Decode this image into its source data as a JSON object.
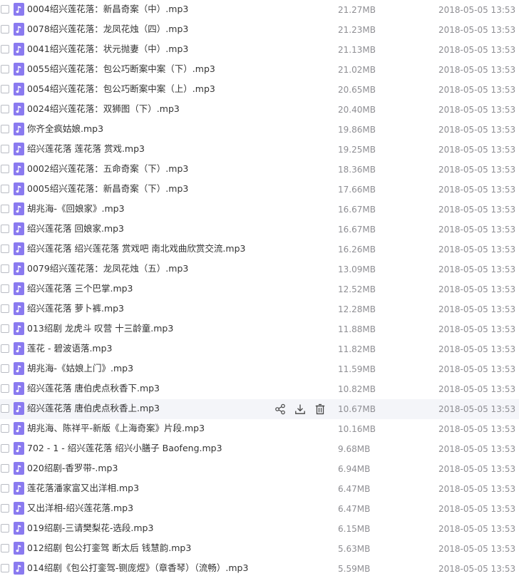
{
  "colors": {
    "file_icon": "#8a7af0",
    "hover_row": "#f4f5f9",
    "meta_text": "#8e8e93",
    "name_text": "#333333"
  },
  "row_icon": "music-file-icon",
  "hover_actions": [
    {
      "name": "share-icon"
    },
    {
      "name": "download-icon"
    },
    {
      "name": "delete-icon"
    }
  ],
  "files": [
    {
      "name": "0004绍兴莲花落：新昌奇案（中）.mp3",
      "size": "21.27MB",
      "date": "2018-05-05 13:53"
    },
    {
      "name": "0078绍兴莲花落：龙凤花烛（四）.mp3",
      "size": "21.23MB",
      "date": "2018-05-05 13:53"
    },
    {
      "name": "0041绍兴莲花落：状元抛妻（中）.mp3",
      "size": "21.13MB",
      "date": "2018-05-05 13:53"
    },
    {
      "name": "0055绍兴莲花落：包公巧断案中案（下）.mp3",
      "size": "21.02MB",
      "date": "2018-05-05 13:53"
    },
    {
      "name": "0054绍兴莲花落：包公巧断案中案（上）.mp3",
      "size": "20.65MB",
      "date": "2018-05-05 13:53"
    },
    {
      "name": "0024绍兴莲花落：双狮图（下）.mp3",
      "size": "20.40MB",
      "date": "2018-05-05 13:53"
    },
    {
      "name": "你齐全疯姑娘.mp3",
      "size": "19.86MB",
      "date": "2018-05-05 13:53"
    },
    {
      "name": "绍兴莲花落 莲花落 赏戏.mp3",
      "size": "19.25MB",
      "date": "2018-05-05 13:53"
    },
    {
      "name": "0002绍兴莲花落：五命奇案（下）.mp3",
      "size": "18.36MB",
      "date": "2018-05-05 13:53"
    },
    {
      "name": "0005绍兴莲花落：新昌奇案（下）.mp3",
      "size": "17.66MB",
      "date": "2018-05-05 13:53"
    },
    {
      "name": "胡兆海-《回娘家》.mp3",
      "size": "16.67MB",
      "date": "2018-05-05 13:53"
    },
    {
      "name": "绍兴莲花落 回娘家.mp3",
      "size": "16.67MB",
      "date": "2018-05-05 13:53"
    },
    {
      "name": "绍兴莲花落 绍兴莲花落 赏戏吧 南北戏曲欣赏交流.mp3",
      "size": "16.26MB",
      "date": "2018-05-05 13:53"
    },
    {
      "name": "0079绍兴莲花落：龙凤花烛（五）.mp3",
      "size": "13.09MB",
      "date": "2018-05-05 13:53"
    },
    {
      "name": "绍兴莲花落 三个巴掌.mp3",
      "size": "12.52MB",
      "date": "2018-05-05 13:53"
    },
    {
      "name": "绍兴莲花落 萝卜裤.mp3",
      "size": "12.28MB",
      "date": "2018-05-05 13:53"
    },
    {
      "name": "013绍剧 龙虎斗 叹营 十三龄童.mp3",
      "size": "11.88MB",
      "date": "2018-05-05 13:53"
    },
    {
      "name": "莲花 - 碧波语落.mp3",
      "size": "11.82MB",
      "date": "2018-05-05 13:53"
    },
    {
      "name": "胡兆海-《姑娘上门》.mp3",
      "size": "11.59MB",
      "date": "2018-05-05 13:53"
    },
    {
      "name": "绍兴莲花落 唐伯虎点秋香下.mp3",
      "size": "10.82MB",
      "date": "2018-05-05 13:53"
    },
    {
      "name": "绍兴莲花落 唐伯虎点秋香上.mp3",
      "size": "10.67MB",
      "date": "2018-05-05 13:53",
      "hovered": true
    },
    {
      "name": "胡兆海、陈祥平-新版《上海奇案》片段.mp3",
      "size": "10.16MB",
      "date": "2018-05-05 13:53"
    },
    {
      "name": "702 - 1 - 绍兴莲花落 绍兴小膳子 Baofeng.mp3",
      "size": "9.68MB",
      "date": "2018-05-05 13:53"
    },
    {
      "name": "020绍剧-香罗带-.mp3",
      "size": "6.94MB",
      "date": "2018-05-05 13:53"
    },
    {
      "name": "莲花落潘家富又出洋相.mp3",
      "size": "6.47MB",
      "date": "2018-05-05 13:53"
    },
    {
      "name": "又出洋相-绍兴莲花落.mp3",
      "size": "6.47MB",
      "date": "2018-05-05 13:53"
    },
    {
      "name": "019绍剧-三请樊梨花-选段.mp3",
      "size": "6.15MB",
      "date": "2018-05-05 13:53"
    },
    {
      "name": "012绍剧 包公打銮驾 断太后 钱慧韵.mp3",
      "size": "5.63MB",
      "date": "2018-05-05 13:53"
    },
    {
      "name": "014绍剧《包公打銮驾-铡庞煜》（章香琴）（流畅）.mp3",
      "size": "5.59MB",
      "date": "2018-05-05 13:53"
    }
  ]
}
